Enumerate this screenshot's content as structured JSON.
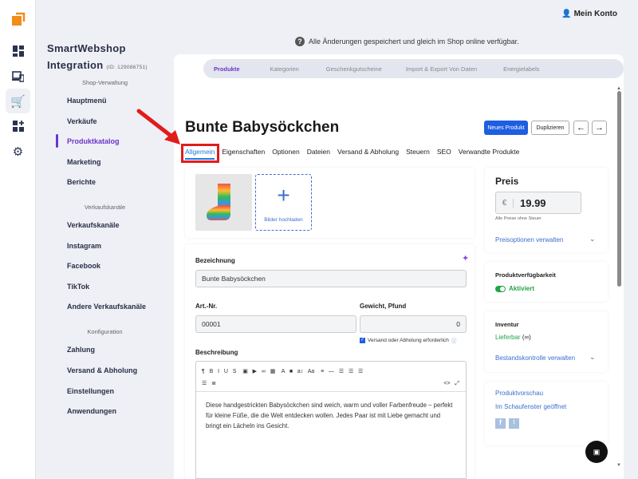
{
  "account": {
    "label": "Mein Konto"
  },
  "notice": "Alle Änderungen gespeichert und gleich im Shop online verfügbar.",
  "brand": {
    "line1": "SmartWebshop",
    "line2": "Integration",
    "id": "(ID: 129086751)"
  },
  "sidebar": {
    "sections": [
      {
        "title": "Shop-Verwaltung",
        "items": [
          "Hauptmenü",
          "Verkäufe",
          "Produktkatalog",
          "Marketing",
          "Berichte"
        ]
      },
      {
        "title": "Verkaufskanäle",
        "items": [
          "Verkaufskanäle",
          "Instagram",
          "Facebook",
          "TikTok",
          "Andere Verkaufskanäle"
        ]
      },
      {
        "title": "Konfiguration",
        "items": [
          "Zahlung",
          "Versand & Abholung",
          "Einstellungen",
          "Anwendungen"
        ]
      }
    ],
    "active": "Produktkatalog"
  },
  "subtabs": [
    "Produkte",
    "Kategorien",
    "Geschenkgutscheine",
    "Import & Export Von Daten",
    "Energielabels"
  ],
  "product": {
    "title": "Bunte Babysöckchen",
    "buttons": {
      "new": "Neues Produkt",
      "duplicate": "Duplizieren",
      "prev": "←",
      "next": "→"
    },
    "tabs": [
      "Allgemein",
      "Eigenschaften",
      "Optionen",
      "Dateien",
      "Versand & Abholung",
      "Steuern",
      "SEO",
      "Verwandte Produkte"
    ],
    "upload_label": "Bilder hochladen",
    "name_label": "Bezeichnung",
    "name_value": "Bunte Babysöckchen",
    "sku_label": "Art.-Nr.",
    "sku_value": "00001",
    "weight_label": "Gewicht, Pfund",
    "weight_value": "0",
    "shipping_required": "Versand oder Abholung erforderlich",
    "desc_label": "Beschreibung",
    "description": "Diese handgestrickten Babysöckchen sind weich, warm und voller Farbenfreude – perfekt für kleine Füße, die die Welt entdecken wollen. Jedes Paar ist mit Liebe gemacht und bringt ein Lächeln ins Gesicht."
  },
  "price": {
    "title": "Preis",
    "currency": "€",
    "value": "19.99",
    "note": "Alle Preise ohne Steuer",
    "manage": "Preisoptionen verwalten"
  },
  "availability": {
    "title": "Produktverfügbarkeit",
    "status": "Aktiviert"
  },
  "inventory": {
    "title": "Inventur",
    "status": "Lieferbar",
    "qty": "(∞)",
    "manage": "Bestandskontrolle verwalten"
  },
  "preview": {
    "link1": "Produktvorschau",
    "link2": "Im Schaufenster geöffnet"
  },
  "colors": {
    "accent": "#6b35c9",
    "primary": "#1e5ee0",
    "orange": "#f28c1b",
    "green": "#22a447",
    "highlight": "#e21b1b"
  }
}
